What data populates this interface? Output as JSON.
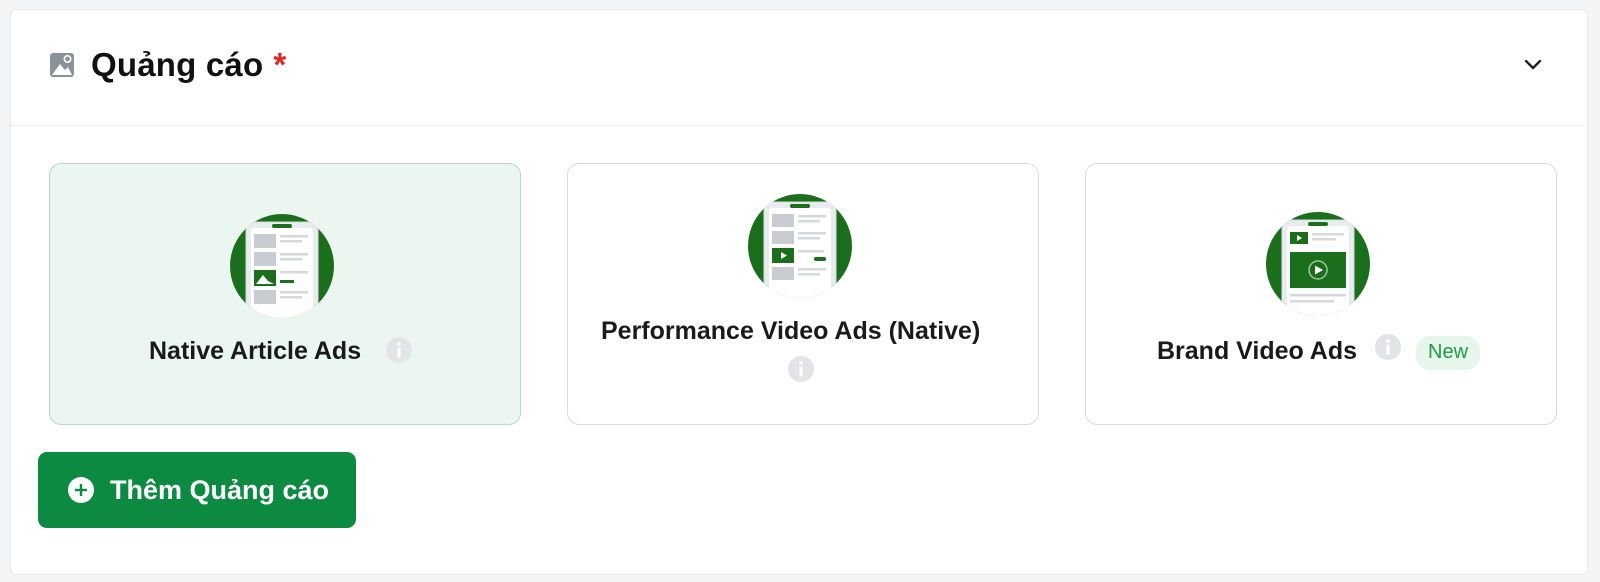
{
  "section": {
    "title": "Quảng cáo",
    "required_mark": "*"
  },
  "cards": [
    {
      "label": "Native Article Ads",
      "selected": true
    },
    {
      "label": "Performance Video Ads (Native)",
      "selected": false
    },
    {
      "label": "Brand Video Ads",
      "badge": "New",
      "selected": false
    }
  ],
  "add_button": {
    "label": "Thêm Quảng cáo"
  },
  "colors": {
    "primary_green": "#0c8a42",
    "thumb_green": "#1b6e1b",
    "selected_bg": "#eaf6ef",
    "required_red": "#e02424",
    "badge_text": "#1f9a48"
  },
  "icons": {
    "header": "image-icon",
    "collapse": "chevron-down-icon",
    "info": "info-icon",
    "add": "plus-circle-icon"
  }
}
